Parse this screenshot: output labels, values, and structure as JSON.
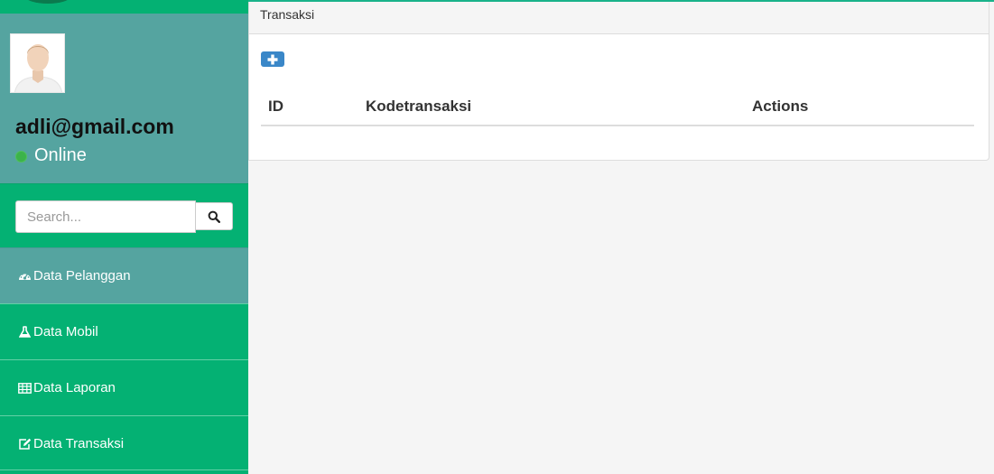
{
  "sidebar": {
    "user": {
      "email": "adli@gmail.com",
      "status": "Online"
    },
    "search": {
      "placeholder": "Search..."
    },
    "menu": [
      {
        "label": "Data Pelanggan",
        "icon": "dashboard-icon",
        "active": true
      },
      {
        "label": "Data Mobil",
        "icon": "flask-icon",
        "active": false
      },
      {
        "label": "Data Laporan",
        "icon": "table-icon",
        "active": false
      },
      {
        "label": "Data Transaksi",
        "icon": "edit-icon",
        "active": false
      }
    ]
  },
  "main": {
    "panel_title": "Transaksi",
    "table": {
      "headers": [
        "ID",
        "Kodetransaksi",
        "Actions"
      ],
      "rows": []
    }
  },
  "colors": {
    "sidebar_green": "#04b173",
    "user_panel_teal": "#55a4a0",
    "add_button_blue": "#3a87c8"
  }
}
